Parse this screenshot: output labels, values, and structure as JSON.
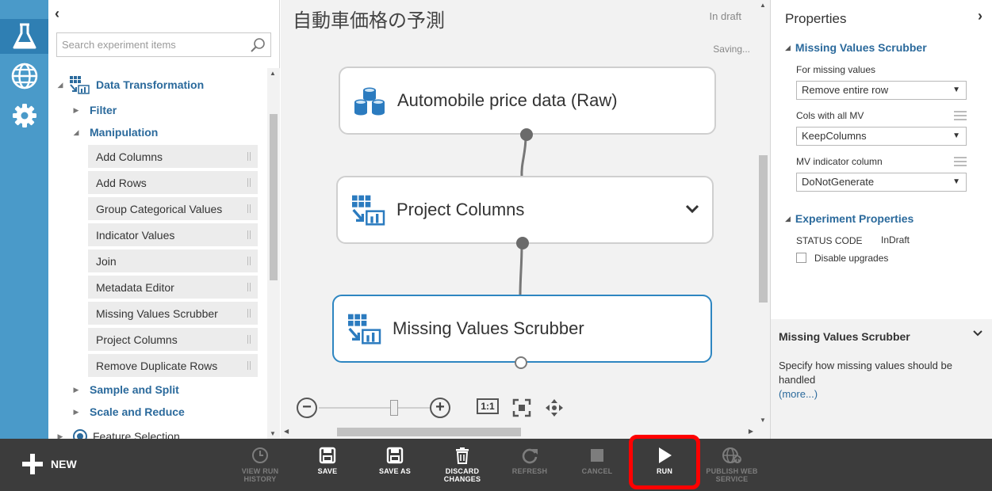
{
  "palette": {
    "search_placeholder": "Search experiment items",
    "category": "Data Transformation",
    "subcategories": {
      "filter": "Filter",
      "manipulation": "Manipulation",
      "sample_split": "Sample and Split",
      "scale_reduce": "Scale and Reduce",
      "feature_selection": "Feature Selection"
    },
    "modules": [
      "Add Columns",
      "Add Rows",
      "Group Categorical Values",
      "Indicator Values",
      "Join",
      "Metadata Editor",
      "Missing Values Scrubber",
      "Project Columns",
      "Remove Duplicate Rows"
    ]
  },
  "canvas": {
    "title": "自動車価格の予測",
    "status": "In draft",
    "saving": "Saving...",
    "nodes": [
      {
        "label": "Automobile price data (Raw)"
      },
      {
        "label": "Project Columns"
      },
      {
        "label": "Missing Values Scrubber"
      }
    ],
    "actual_size_label": "1:1"
  },
  "properties": {
    "title": "Properties",
    "module_section": "Missing Values Scrubber",
    "for_missing_label": "For missing values",
    "for_missing_value": "Remove entire row",
    "cols_mv_label": "Cols with all MV",
    "cols_mv_value": "KeepColumns",
    "mv_indicator_label": "MV indicator column",
    "mv_indicator_value": "DoNotGenerate",
    "experiment_section": "Experiment Properties",
    "status_code_label": "STATUS CODE",
    "status_code_value": "InDraft",
    "disable_upgrades": "Disable upgrades"
  },
  "help": {
    "title": "Missing Values Scrubber",
    "text": "Specify how missing values should be handled",
    "more": "(more...)"
  },
  "toolbar": {
    "new": "NEW",
    "view_run_history_1": "VIEW RUN",
    "view_run_history_2": "HISTORY",
    "save": "SAVE",
    "save_as": "SAVE AS",
    "discard_1": "DISCARD",
    "discard_2": "CHANGES",
    "refresh": "REFRESH",
    "cancel": "CANCEL",
    "run": "RUN",
    "publish_1": "PUBLISH WEB",
    "publish_2": "SERVICE"
  },
  "colors": {
    "rail": "#4a9ac9",
    "accent": "#2b6a9c",
    "selected_border": "#2e86c1",
    "toolbar_bg": "#3c3c3c",
    "highlight": "#ff0000"
  }
}
